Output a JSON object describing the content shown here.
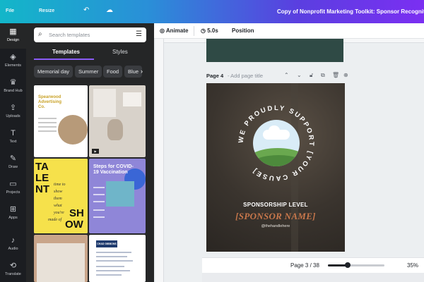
{
  "topbar": {
    "file_label": "File",
    "resize_label": "Resize",
    "undo_icon": "undo-icon",
    "cloud_icon": "cloud-sync-icon",
    "document_title": "Copy of Nonprofit Marketing Toolkit: Sponsor Recognition ("
  },
  "rail": {
    "items": [
      {
        "label": "Design",
        "icon": "layout-icon",
        "glyph": "▦"
      },
      {
        "label": "Elements",
        "icon": "shapes-icon",
        "glyph": "◈"
      },
      {
        "label": "Brand Hub",
        "icon": "brand-icon",
        "glyph": "♛"
      },
      {
        "label": "Uploads",
        "icon": "cloud-upload-icon",
        "glyph": "⇪"
      },
      {
        "label": "Text",
        "icon": "text-icon",
        "glyph": "T"
      },
      {
        "label": "Draw",
        "icon": "pen-icon",
        "glyph": "✎"
      },
      {
        "label": "Projects",
        "icon": "folder-icon",
        "glyph": "▭"
      },
      {
        "label": "Apps",
        "icon": "apps-icon",
        "glyph": "⊞"
      },
      {
        "label": "Audio",
        "icon": "music-icon",
        "glyph": "♪"
      },
      {
        "label": "Translate",
        "icon": "translate-icon",
        "glyph": "⟲"
      }
    ]
  },
  "panel": {
    "search_placeholder": "Search templates",
    "tabs": [
      "Templates",
      "Styles"
    ],
    "chips": [
      "Memorial day",
      "Summer",
      "Food",
      "Blue"
    ],
    "templates": {
      "t1_heading": "Spearwood Advertising Co.",
      "t3_word_top": "TA",
      "t3_word_mid": "LE",
      "t3_word_low": "NT",
      "t3_script_1": "time to",
      "t3_script_2": "show",
      "t3_script_3": "them",
      "t3_script_4": "what",
      "t3_script_5": "you're",
      "t3_script_6": "made of",
      "t3_word_show_1": "SH",
      "t3_word_show_2": "OW",
      "t4_heading": "Steps for COVID-19 Vaccination",
      "t6_heading": "CHAD GIBBONS"
    }
  },
  "toolbar": {
    "animate": "Animate",
    "duration": "5.0s",
    "position": "Position"
  },
  "page": {
    "label": "Page 4",
    "add_title": "- Add page title",
    "ring_text": "WE PROUDLY SUPPORT [YOUR CAUSE]",
    "level": "SPONSORSHIP LEVEL",
    "sponsor_name": "[SPONSOR NAME]",
    "handle": "@thehandlehere"
  },
  "bottombar": {
    "page_indicator": "Page 3 / 38",
    "zoom_value": 0.35,
    "zoom": "35%"
  },
  "colors": {
    "accent": "#8b5cf6",
    "sponsor_name": "#c8774b"
  }
}
